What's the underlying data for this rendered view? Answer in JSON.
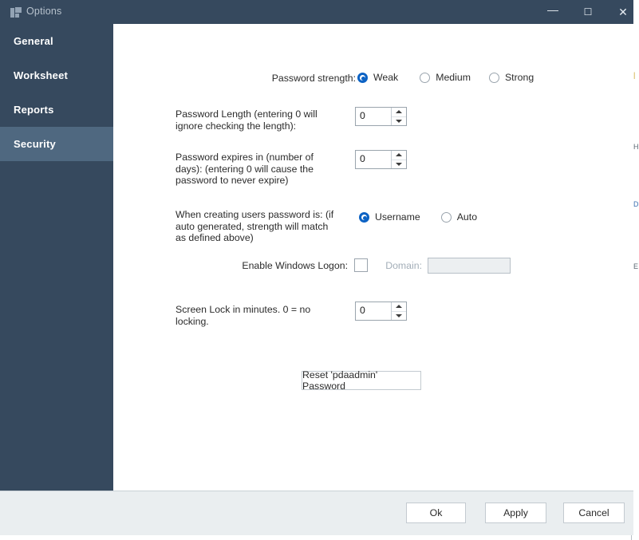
{
  "window": {
    "title": "Options",
    "icon": "app-squares-icon",
    "controls": {
      "minimize": "—",
      "maximize": "☐",
      "close": "✕"
    },
    "titlebar_color": "#36495e"
  },
  "sidebar": {
    "background": "#36495e",
    "selected_background": "#4f6880",
    "items": [
      {
        "label": "General",
        "selected": false
      },
      {
        "label": "Worksheet",
        "selected": false
      },
      {
        "label": "Reports",
        "selected": false
      },
      {
        "label": "Security",
        "selected": true
      }
    ]
  },
  "security_panel": {
    "password_strength": {
      "label": "Password strength:",
      "options": [
        {
          "label": "Weak",
          "selected": true
        },
        {
          "label": "Medium",
          "selected": false
        },
        {
          "label": "Strong",
          "selected": false
        }
      ]
    },
    "password_length": {
      "label": "Password Length (entering 0 will ignore checking the length):",
      "value": "0"
    },
    "password_expires": {
      "label": "Password expires in (number of days): (entering 0 will cause the password to never expire)",
      "value": "0"
    },
    "creating_users_password": {
      "label": "When creating users password is: (if auto generated, strength will match as defined above)",
      "options": [
        {
          "label": "Username",
          "selected": true
        },
        {
          "label": "Auto",
          "selected": false
        }
      ]
    },
    "windows_logon": {
      "label": "Enable Windows Logon:",
      "checked": false,
      "domain_label": "Domain:",
      "domain_value": "",
      "domain_enabled": false
    },
    "screen_lock": {
      "label": "Screen Lock in minutes. 0 = no locking.",
      "value": "0"
    },
    "reset_password_button": "Reset 'pdaadmin' Password"
  },
  "footer": {
    "buttons": [
      {
        "label": "Ok"
      },
      {
        "label": "Apply"
      },
      {
        "label": "Cancel"
      }
    ],
    "background": "#eaeef0"
  },
  "accent_color": "#0c62c4"
}
